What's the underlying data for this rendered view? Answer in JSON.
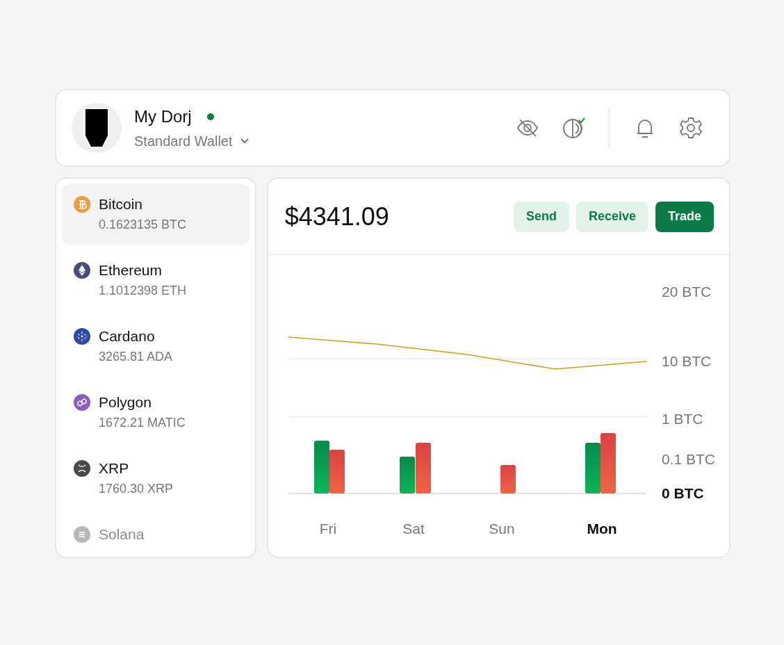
{
  "wallet": {
    "name": "My Dorj",
    "online": true,
    "type": "Standard Wallet"
  },
  "assets": [
    {
      "name": "Bitcoin",
      "amount": "0.1623135 BTC",
      "color": "#f29a3c",
      "selected": true,
      "dimmed": false
    },
    {
      "name": "Ethereum",
      "amount": "1.1012398 ETH",
      "color": "#4a4a82",
      "selected": false,
      "dimmed": false
    },
    {
      "name": "Cardano",
      "amount": "3265.81 ADA",
      "color": "#2d4aa8",
      "selected": false,
      "dimmed": false
    },
    {
      "name": "Polygon",
      "amount": "1672.21 MATIC",
      "color": "#8a5fc0",
      "selected": false,
      "dimmed": false
    },
    {
      "name": "XRP",
      "amount": "1760.30 XRP",
      "color": "#4a4a4a",
      "selected": false,
      "dimmed": false
    },
    {
      "name": "Solana",
      "color": "#b8b8b8",
      "selected": false,
      "dimmed": true
    }
  ],
  "balance": "$4341.09",
  "actions": [
    {
      "label": "Send",
      "primary": false
    },
    {
      "label": "Receive",
      "primary": false
    },
    {
      "label": "Trade",
      "primary": true
    }
  ],
  "chart": {
    "y_labels": [
      {
        "label": "20 BTC",
        "bold": false
      },
      {
        "label": "10 BTC",
        "bold": false
      },
      {
        "label": "1 BTC",
        "bold": false
      },
      {
        "label": "0.1 BTC",
        "bold": false
      },
      {
        "label": "0 BTC",
        "bold": true
      }
    ],
    "days": [
      {
        "label": "Fri",
        "selected": false
      },
      {
        "label": "Sat",
        "selected": false
      },
      {
        "label": "Sun",
        "selected": false
      },
      {
        "label": "Mon",
        "selected": true
      }
    ]
  }
}
